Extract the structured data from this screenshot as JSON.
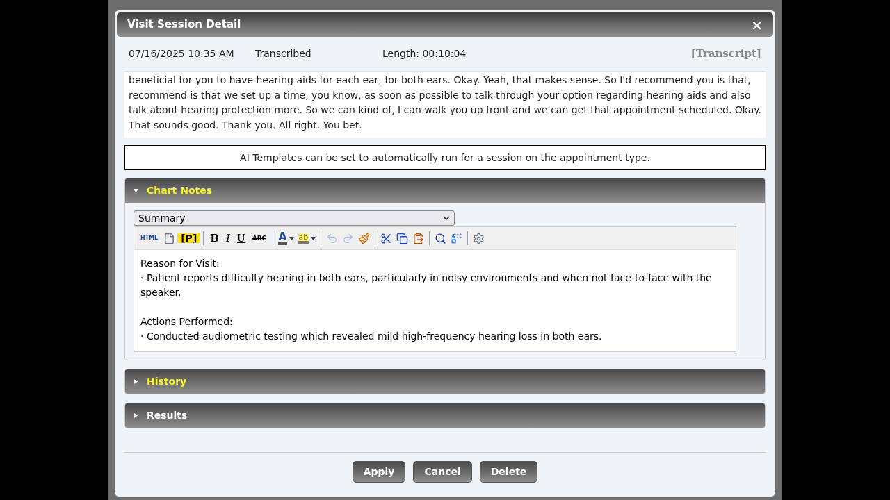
{
  "dialog": {
    "title": "Visit Session Detail",
    "close": "×"
  },
  "session": {
    "datetime": "07/16/2025 10:35 AM",
    "status": "Transcribed",
    "length": "Length: 00:10:04",
    "transcript_link": "[Transcript]"
  },
  "transcript": "beneficial for you to have hearing aids for each ear, for both ears. Okay. Yeah, that makes sense. So I'd recommend you is that, recommend is that we set up a time, you know, as soon as possible to talk through your option regarding hearing aids and also talk about hearing protection more. So we can kind of, I can walk you up front and we can get that appointment scheduled. Okay. That sounds good. Thank you. All right. You bet.",
  "info": "AI Templates can be set to automatically run for a session on the appointment type.",
  "sections": [
    {
      "title": "Chart Notes",
      "expanded": true,
      "highlighted": true,
      "template": "Summary",
      "toolbar": [
        {
          "kind": "text",
          "label": "HTML"
        },
        {
          "kind": "icon"
        },
        {
          "kind": "text",
          "label": "[P]"
        },
        {
          "kind": "sep"
        },
        {
          "kind": "text",
          "label": "B"
        },
        {
          "kind": "text",
          "label": "I"
        },
        {
          "kind": "text",
          "label": "U"
        },
        {
          "kind": "text",
          "label": "ABC"
        },
        {
          "kind": "sep"
        },
        {
          "kind": "color",
          "label": "A"
        },
        {
          "kind": "color",
          "label": "ab"
        },
        {
          "kind": "sep"
        },
        {
          "kind": "icon",
          "disabled": true
        },
        {
          "kind": "icon",
          "disabled": true
        },
        {
          "kind": "icon",
          "disabled": false
        },
        {
          "kind": "sep"
        },
        {
          "kind": "icon",
          "disabled": false
        },
        {
          "kind": "icon",
          "disabled": false
        },
        {
          "kind": "icon",
          "disabled": false
        },
        {
          "kind": "sep"
        },
        {
          "kind": "icon",
          "disabled": false
        },
        {
          "kind": "icon",
          "disabled": false
        },
        {
          "kind": "sep"
        },
        {
          "kind": "icon",
          "disabled": false
        }
      ],
      "content": [
        {
          "kind": "heading",
          "text": "Reason for Visit:"
        },
        {
          "kind": "bullet",
          "text": "· Patient reports difficulty hearing in both ears, particularly in noisy environments and when not face-to-face with the speaker."
        },
        {
          "kind": "blank"
        },
        {
          "kind": "heading",
          "text": "Actions Performed:"
        },
        {
          "kind": "bullet",
          "text": "· Conducted audiometric testing which revealed mild high-frequency hearing loss in both ears."
        }
      ]
    },
    {
      "title": "History",
      "expanded": false,
      "highlighted": true
    },
    {
      "title": "Results",
      "expanded": false,
      "highlighted": false
    }
  ],
  "buttons": [
    "Apply",
    "Cancel",
    "Delete"
  ]
}
